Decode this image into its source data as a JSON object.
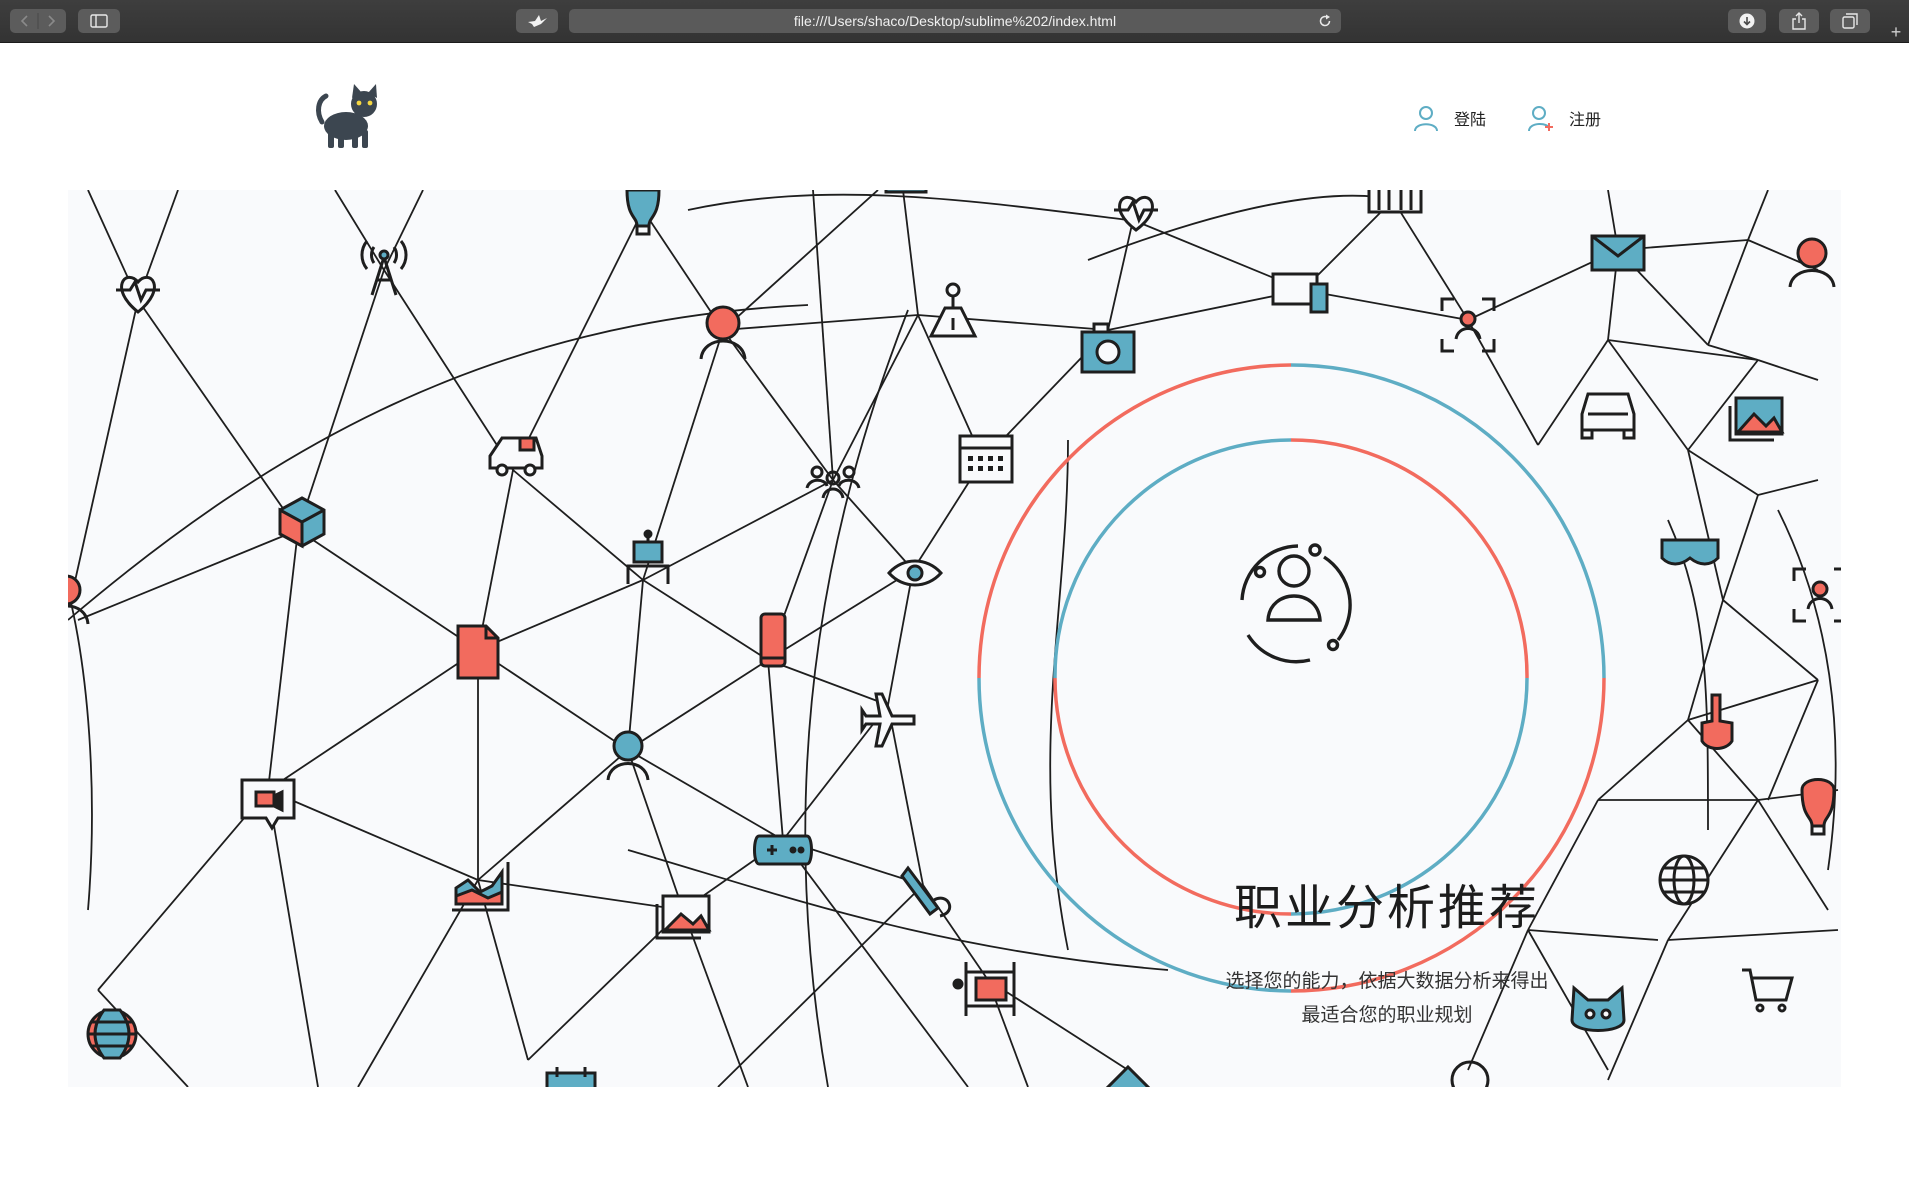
{
  "browser": {
    "url": "file:///Users/shaco/Desktop/sublime%202/index.html",
    "new_tab_label": "+",
    "icons": [
      "chevron-left-icon",
      "chevron-right-icon",
      "sidebar-icon",
      "bird-icon",
      "reload-icon",
      "download-icon",
      "share-icon",
      "tabs-icon"
    ]
  },
  "header": {
    "logo_icon": "cat-icon",
    "login_label": "登陆",
    "register_label": "注册"
  },
  "hero": {
    "title": "职业分析推荐",
    "description_line1": "选择您的能力，依据大数据分析来得出",
    "description_line2": "最适合您的职业规划"
  },
  "colors": {
    "accent_blue": "#5eadc4",
    "accent_red": "#f26b5e",
    "line": "#1e1e1e",
    "hero_bg": "#f9fafc"
  }
}
